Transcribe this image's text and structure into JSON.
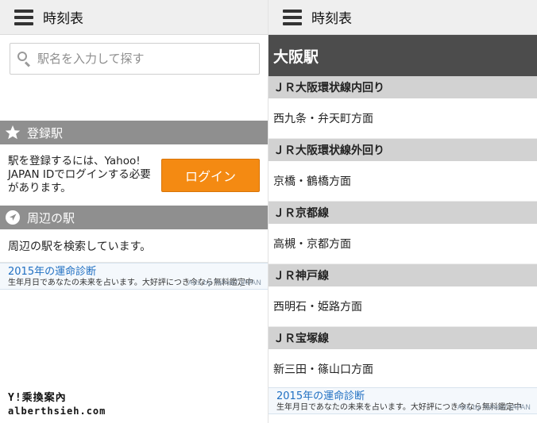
{
  "left": {
    "app_title": "時刻表",
    "search": {
      "placeholder": "駅名を入力して探す",
      "value": ""
    },
    "registered": {
      "header": "登録駅",
      "message": "駅を登録するには、Yahoo! JAPAN IDでログインする必要があります。",
      "login_label": "ログイン"
    },
    "nearby": {
      "header": "周辺の駅",
      "status": "周辺の駅を検索しています。"
    },
    "ad": {
      "title": "2015年の運命診断",
      "body": "生年月日であなたの未来を占います。大好評につき今なら無料鑑定中",
      "credit": "Ads by Yahoo! JAPAN"
    }
  },
  "right": {
    "app_title": "時刻表",
    "station": "大阪駅",
    "lines": [
      {
        "name": "ＪＲ大阪環状線内回り",
        "direction": "西九条・弁天町方面"
      },
      {
        "name": "ＪＲ大阪環状線外回り",
        "direction": "京橋・鶴橋方面"
      },
      {
        "name": "ＪＲ京都線",
        "direction": "高槻・京都方面"
      },
      {
        "name": "ＪＲ神戸線",
        "direction": "西明石・姫路方面"
      },
      {
        "name": "ＪＲ宝塚線",
        "direction": "新三田・篠山口方面"
      }
    ],
    "ad": {
      "title": "2015年の運命診断",
      "body": "生年月日であなたの未来を占います。大好評につき今なら無料鑑定中",
      "credit": "Ads by Yahoo! JAPAN"
    }
  },
  "watermark": {
    "line1": "Y!乘換案內",
    "line2": "alberthsieh.com"
  },
  "colors": {
    "accent_orange": "#f48a12",
    "section_gray": "#8f8f8f",
    "station_bar": "#4c4c4c",
    "line_header": "#d2d2d2",
    "ad_link": "#1f6fc2"
  },
  "icons": {
    "menu": "hamburger-icon",
    "search": "search-icon",
    "registered": "star-icon",
    "nearby": "location-arrow-icon"
  }
}
